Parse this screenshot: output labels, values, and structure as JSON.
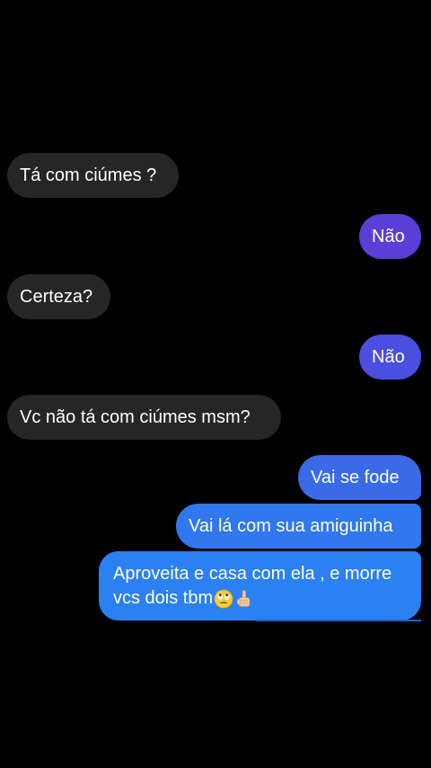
{
  "conversation": {
    "messages": [
      {
        "from": "them",
        "text": "Tá com ciúmes ?"
      },
      {
        "from": "me",
        "text": "Não"
      },
      {
        "from": "them",
        "text": "Certeza?"
      },
      {
        "from": "me",
        "text": "Não"
      },
      {
        "from": "them",
        "text": "Vc não tá com ciúmes msm?"
      },
      {
        "from": "me",
        "text": "Vai se fode"
      },
      {
        "from": "me",
        "text": "Vai lá com sua amiguinha"
      },
      {
        "from": "me",
        "line1": "Aproveita e casa com ela , e morre",
        "line2": "vcs dois tbm",
        "emojis": [
          "face-with-rolling-eyes-icon",
          "pointing-up-hand-icon"
        ]
      }
    ]
  },
  "colors": {
    "background": "#000000",
    "received_bubble": "#262626",
    "sent_gradient": [
      "#5a3fd6",
      "#4a4fdf",
      "#3a6ae6",
      "#2f78ee",
      "#2b80f2"
    ],
    "text": "#ffffff"
  }
}
